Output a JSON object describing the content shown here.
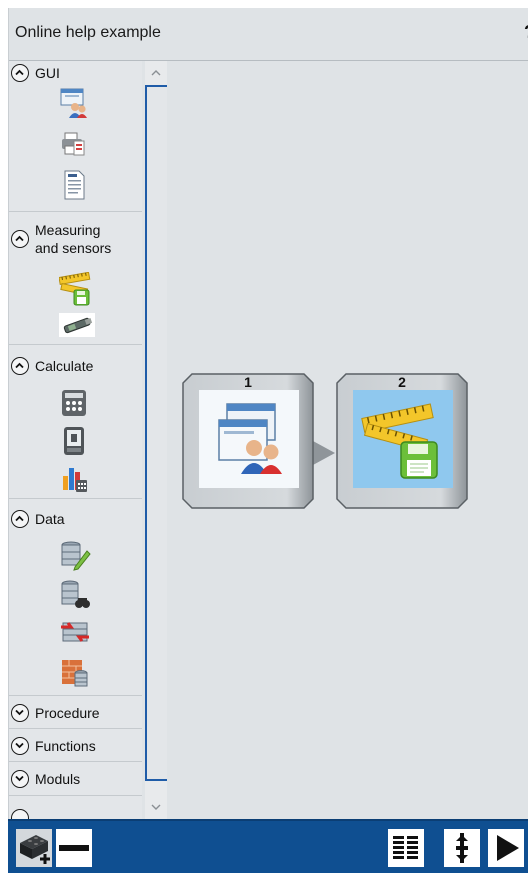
{
  "window": {
    "title": "Online help example",
    "help_label": "?"
  },
  "sidebar": {
    "groups": [
      {
        "label": "GUI",
        "state": "expanded",
        "icons": [
          "dialog-users-icon",
          "printer-icon",
          "document-icon"
        ]
      },
      {
        "label_line1": "Measuring",
        "label_line2": "and sensors",
        "state": "expanded",
        "icons": [
          "ruler-save-icon",
          "sensor-device-icon"
        ]
      },
      {
        "label": "Calculate",
        "state": "expanded",
        "icons": [
          "calculator-icon",
          "phone-calculator-icon",
          "chart-calculator-icon"
        ]
      },
      {
        "label": "Data",
        "state": "expanded",
        "icons": [
          "database-edit-icon",
          "database-search-icon",
          "database-sync-icon",
          "database-bricks-icon"
        ]
      },
      {
        "label": "Procedure",
        "state": "collapsed"
      },
      {
        "label": "Functions",
        "state": "collapsed"
      },
      {
        "label": "Moduls",
        "state": "collapsed"
      }
    ]
  },
  "canvas": {
    "nodes": [
      {
        "number": "1",
        "icon": "dialog-users-icon",
        "background": "#f4f8fb"
      },
      {
        "number": "2",
        "icon": "ruler-save-icon",
        "background": "#8fc8ee"
      }
    ]
  },
  "toolbar": {
    "buttons": [
      "add-block-icon",
      "remove-icon",
      "list-view-icon",
      "step-icon",
      "play-icon"
    ]
  },
  "colors": {
    "toolbar_bg": "#0f4f91",
    "scroll_thumb_border": "#1f5ca8",
    "panel_bg": "#dfe3e6"
  }
}
